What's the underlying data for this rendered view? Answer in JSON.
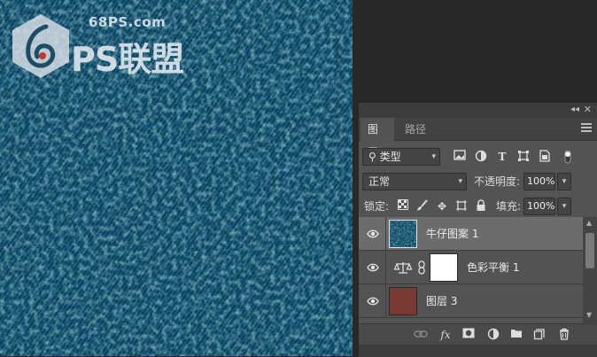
{
  "watermark": {
    "url": "68PS.com",
    "brand": "PS联盟"
  },
  "panel": {
    "collapse_icon": "double-chevron-right-icon",
    "close_icon": "close-icon",
    "tabs": [
      {
        "label": "图层",
        "active": true
      },
      {
        "label": "路径",
        "active": false
      }
    ],
    "menu_icon": "hamburger-menu-icon"
  },
  "filter": {
    "search_icon": "search-icon",
    "selected": "类型",
    "icons": [
      "image-filter-icon",
      "adjustment-filter-icon",
      "type-filter-icon",
      "shape-filter-icon",
      "smart-object-filter-icon",
      "filter-toggle-icon"
    ]
  },
  "blend": {
    "mode": "正常",
    "opacity_label": "不透明度:",
    "opacity": "100%"
  },
  "lock": {
    "label": "锁定:",
    "icons": [
      "lock-transparency-icon",
      "lock-pixels-icon",
      "lock-position-icon",
      "lock-artboard-icon",
      "lock-all-icon"
    ],
    "fill_label": "填充:",
    "fill": "100%"
  },
  "layers": [
    {
      "name": "牛仔图案",
      "suffix": "1",
      "selected": true,
      "thumb_color": "#0f4c66",
      "type": "pattern"
    },
    {
      "name": "色彩平衡",
      "suffix": "1",
      "selected": false,
      "thumb_color": "#ffffff",
      "type": "adjustment"
    },
    {
      "name": "图层",
      "suffix": "3",
      "selected": false,
      "thumb_color": "#7a3a34",
      "type": "pixel"
    }
  ],
  "bottom_icons": [
    "link-layers-icon",
    "fx-icon",
    "add-mask-icon",
    "new-adjustment-icon",
    "new-group-icon",
    "new-layer-icon",
    "delete-layer-icon"
  ],
  "colors": {
    "canvas": "#0f4c66",
    "panel_bg": "#535353",
    "selected_row": "#6c6c6c",
    "red_layer": "#7a3a34"
  }
}
